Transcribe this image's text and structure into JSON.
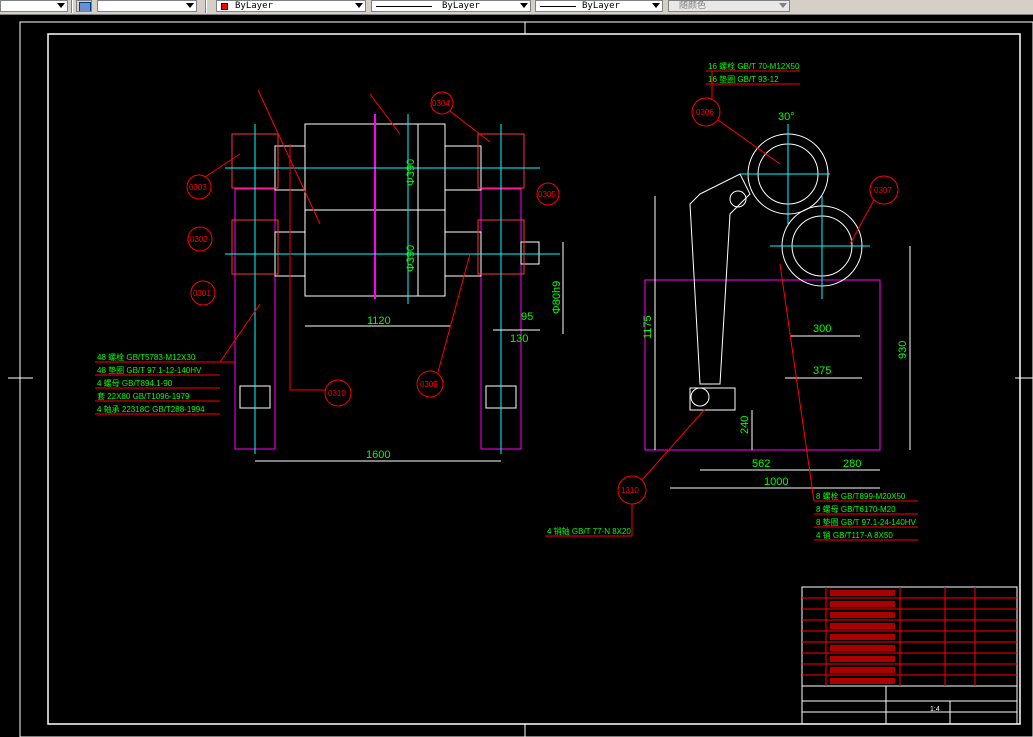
{
  "toolbar": {
    "layer_combo_value": "ByLayer",
    "linetype_value": "ByLayer",
    "lineweight_value": "ByLayer",
    "plotstyle_value": "随颜色",
    "color_accent": "#ff0000"
  },
  "front_view": {
    "part_callouts": [
      "0303",
      "0302",
      "0301",
      "0304",
      "0305",
      "0310",
      "0309"
    ],
    "dims": {
      "dia_upper": "Φ390",
      "dia_lower": "Φ390",
      "length_1120": "1120",
      "overall_1600": "1600",
      "dim_95": "95",
      "dim_130": "130",
      "shaft_dia": "Φ80h9"
    },
    "parts_list": [
      "48 螺栓 GB/T5783-M12X30",
      "48 垫圈 GB/T 97.1-12-140HV",
      "4 螺母 GB/T894.1-90",
      "套 22X80 GB/T1096-1979",
      "4 轴承 22318C GB/T288-1994"
    ]
  },
  "side_view": {
    "part_callouts": [
      "0306",
      "0307",
      "1310"
    ],
    "top_notes": [
      "16 螺栓 GB/T 70-M12X50",
      "16 垫圈 GB/T 93-12"
    ],
    "dims": {
      "angle": "30°",
      "height_1175": "1175",
      "height_930": "930",
      "dim_300": "300",
      "dim_375": "375",
      "dim_240": "240",
      "dim_562": "562",
      "dim_280": "280",
      "dim_1000": "1000"
    },
    "bolt_notes": [
      "8 螺栓 GB/T899-M20X50",
      "8 螺母 GB/T6170-M20",
      "8 垫圈 GB/T 97.1-24-140HV",
      "4 销 GB/T117-A 8X50"
    ],
    "pin_note": "4 销轴 GB/T 77-N 8X20"
  },
  "title_block": {
    "scale": "1:4"
  }
}
